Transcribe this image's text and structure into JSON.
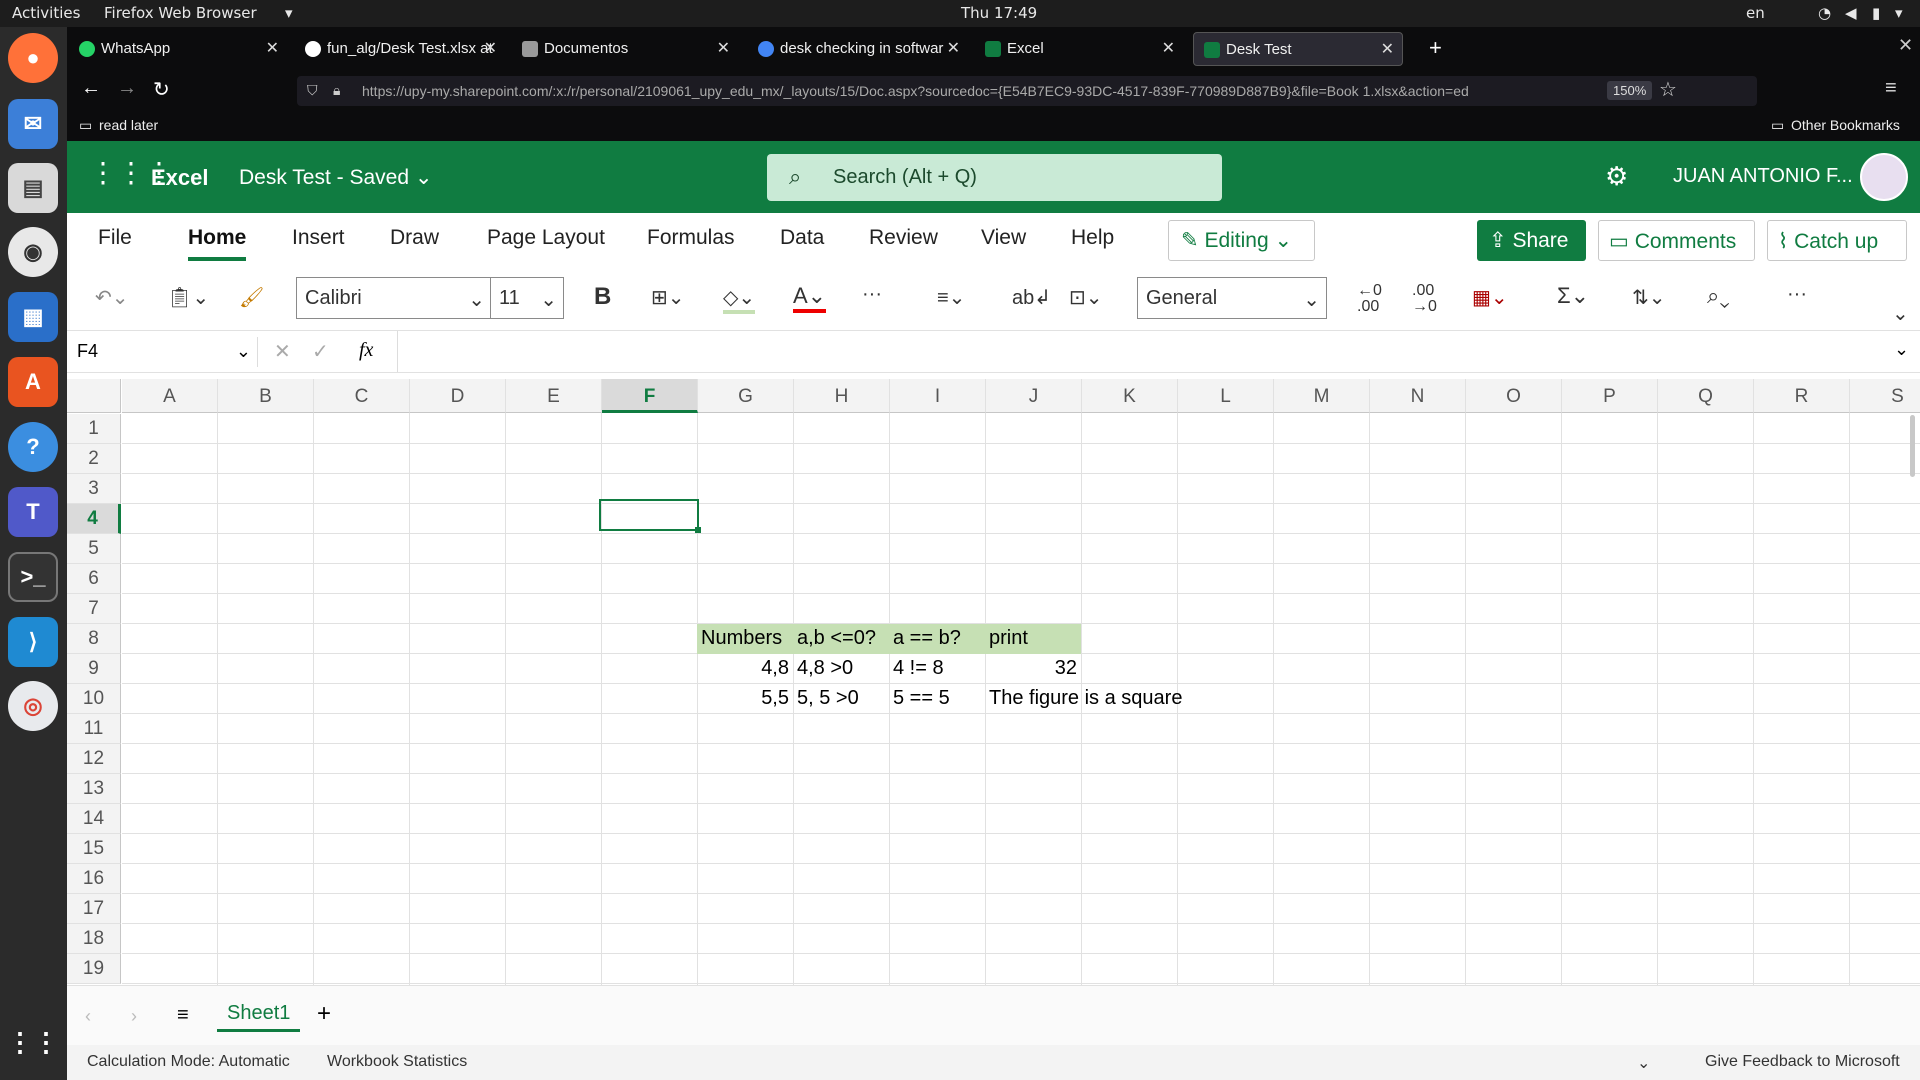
{
  "system": {
    "activities": "Activities",
    "app_menu": "Firefox Web Browser",
    "clock": "Thu 17:49",
    "lang": "en"
  },
  "tabs": [
    {
      "label": "WhatsApp",
      "color": "#25d366"
    },
    {
      "label": "fun_alg/Desk Test.xlsx at",
      "color": "#ffffff"
    },
    {
      "label": "Documentos",
      "color": "#cccccc"
    },
    {
      "label": "desk checking in softwar",
      "color": "#4285f4"
    },
    {
      "label": "Excel",
      "color": "#107c41"
    },
    {
      "label": "Desk Test",
      "color": "#107c41"
    }
  ],
  "url": "https://upy-my.sharepoint.com/:x:/r/personal/2109061_upy_edu_mx/_layouts/15/Doc.aspx?sourcedoc={E54B7EC9-93DC-4517-839F-770989D887B9}&file=Book 1.xlsx&action=ed",
  "zoom": "150%",
  "bookmarks": {
    "read_later": "read later",
    "other": "Other Bookmarks"
  },
  "excel": {
    "app": "Excel",
    "doc_title": "Desk Test",
    "saved": "Saved",
    "search_placeholder": "Search (Alt + Q)",
    "user": "JUAN ANTONIO F..."
  },
  "menu": [
    "File",
    "Home",
    "Insert",
    "Draw",
    "Page Layout",
    "Formulas",
    "Data",
    "Review",
    "View",
    "Help"
  ],
  "menu_right": {
    "editing": "Editing",
    "share": "Share",
    "comments": "Comments",
    "catchup": "Catch up"
  },
  "toolbar": {
    "font": "Calibri",
    "size": "11",
    "bold": "B",
    "number_format": "General",
    "more": "···"
  },
  "formula": {
    "namebox": "F4",
    "fx": "fx",
    "content": ""
  },
  "columns": [
    "A",
    "B",
    "C",
    "D",
    "E",
    "F",
    "G",
    "H",
    "I",
    "J",
    "K",
    "L",
    "M",
    "N",
    "O",
    "P",
    "Q",
    "R",
    "S"
  ],
  "rows": [
    "1",
    "2",
    "3",
    "4",
    "5",
    "6",
    "7",
    "8",
    "9",
    "10",
    "11",
    "12",
    "13",
    "14",
    "15",
    "16",
    "17",
    "18",
    "19"
  ],
  "cells": {
    "G8": "Numbers",
    "H8": "a,b <=0?",
    "I8": "a == b?",
    "J8": "print",
    "G9": "4,8",
    "H9": "4,8 >0",
    "I9": "4 != 8",
    "J9": "32",
    "G10": "5,5",
    "H10": "5, 5 >0",
    "I10": "5 == 5",
    "J10": "The figure is a square"
  },
  "sheet": {
    "name": "Sheet1"
  },
  "status": {
    "calc": "Calculation Mode: Automatic",
    "stats": "Workbook Statistics",
    "feedback": "Give Feedback to Microsoft"
  }
}
